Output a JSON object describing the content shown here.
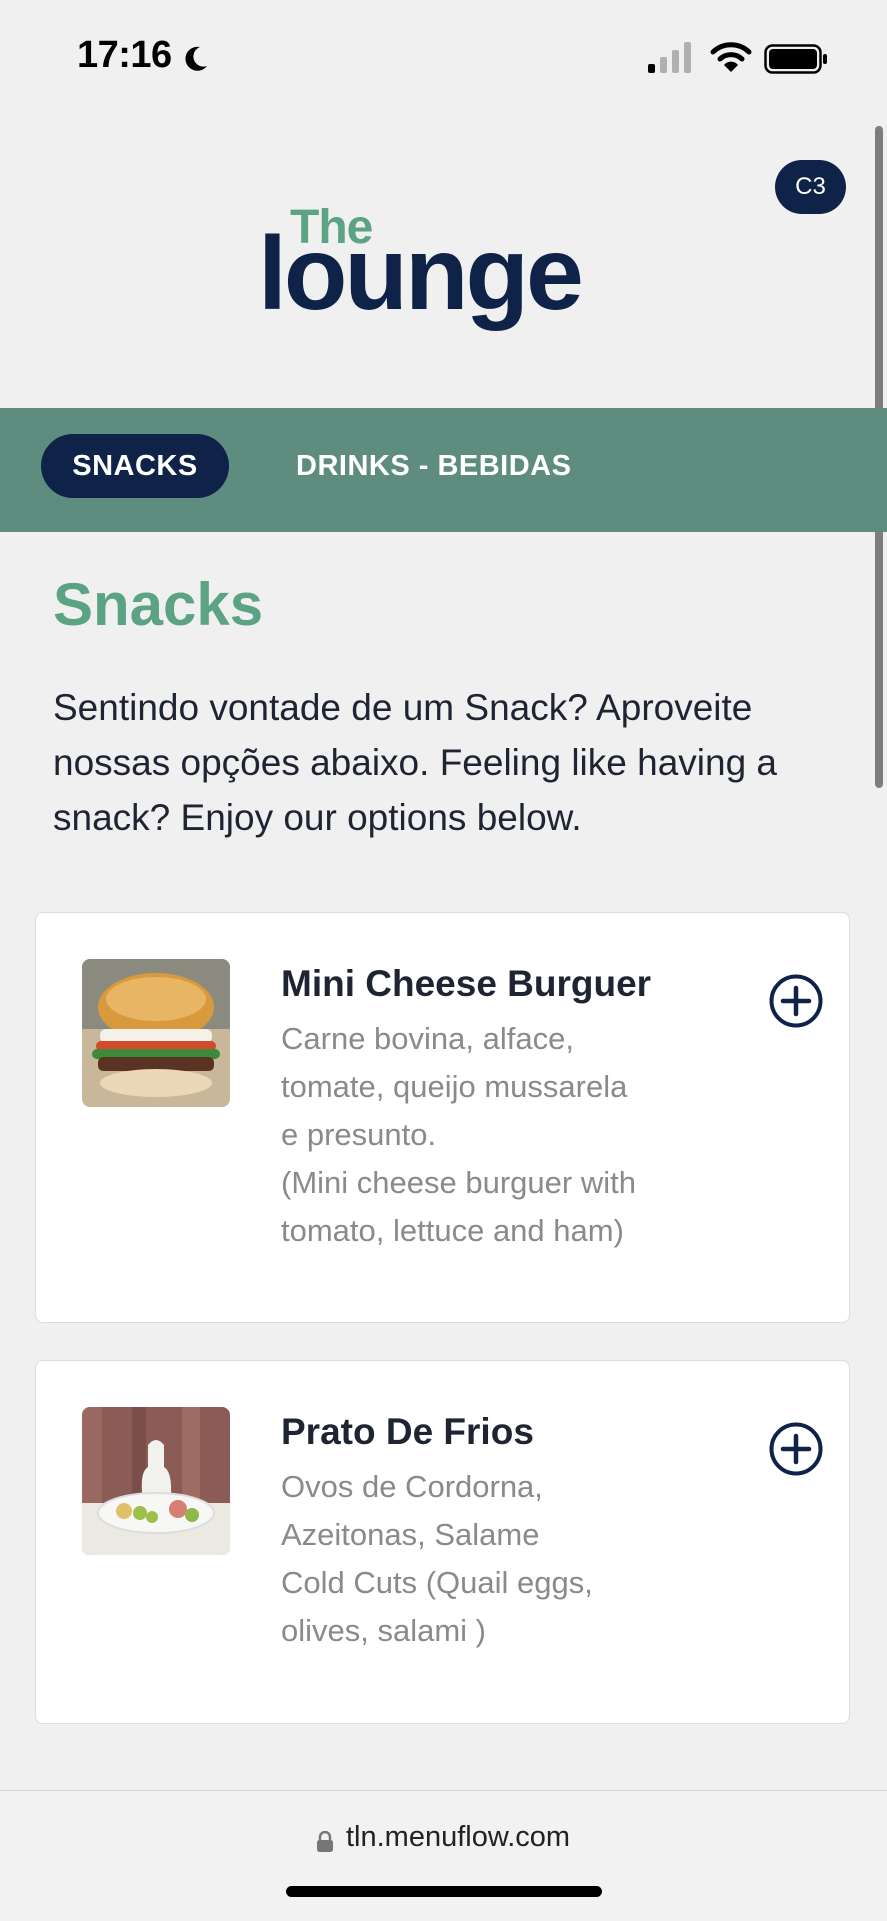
{
  "status_bar": {
    "time": "17:16"
  },
  "header": {
    "logo_small": "The",
    "logo_large": "lounge",
    "user_badge": "C3"
  },
  "tabs": [
    {
      "label": "SNACKS",
      "active": true
    },
    {
      "label": "DRINKS - BEBIDAS",
      "active": false
    }
  ],
  "section": {
    "title": "Snacks",
    "description": "Sentindo vontade de um Snack? Aproveite nossas opções abaixo. Feeling like having a snack? Enjoy our options below."
  },
  "items": [
    {
      "name": "Mini Cheese Burguer",
      "description": "Carne bovina, alface,\ntomate, queijo mussarela\ne presunto.\n(Mini cheese burguer with\ntomato, lettuce and ham)"
    },
    {
      "name": "Prato De Frios",
      "description": "Ovos de Cordorna,\nAzeitonas, Salame\nCold Cuts (Quail eggs,\nolives, salami )"
    }
  ],
  "browser": {
    "url": "tln.menuflow.com"
  },
  "colors": {
    "navy": "#0f2247",
    "green_accent": "#5ba383",
    "tab_bar": "#5e8d7f"
  }
}
